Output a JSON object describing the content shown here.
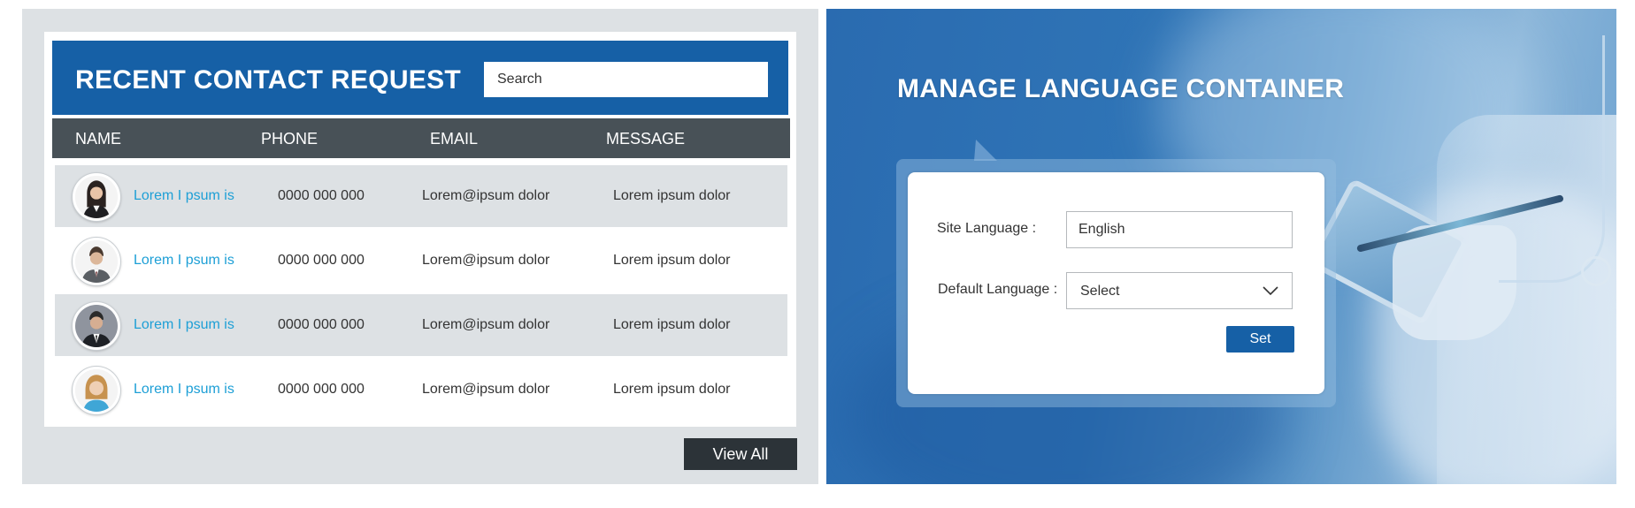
{
  "contacts": {
    "title": "RECENT CONTACT REQUEST",
    "search_placeholder": "Search",
    "columns": [
      "NAME",
      "PHONE",
      "EMAIL",
      "MESSAGE"
    ],
    "rows": [
      {
        "avatar": "avatar-woman-dark-hair-icon",
        "name": "Lorem I psum is",
        "phone": "0000 000 000",
        "email": "Lorem@ipsum dolor",
        "message": "Lorem ipsum dolor"
      },
      {
        "avatar": "avatar-man-suit-icon",
        "name": "Lorem I psum is",
        "phone": "0000 000 000",
        "email": "Lorem@ipsum dolor",
        "message": "Lorem ipsum dolor"
      },
      {
        "avatar": "avatar-man-tie-icon",
        "name": "Lorem I psum is",
        "phone": "0000 000 000",
        "email": "Lorem@ipsum dolor",
        "message": "Lorem ipsum dolor"
      },
      {
        "avatar": "avatar-woman-blonde-icon",
        "name": "Lorem I psum is",
        "phone": "0000 000 000",
        "email": "Lorem@ipsum dolor",
        "message": "Lorem ipsum dolor"
      }
    ],
    "view_all_label": "View All"
  },
  "language": {
    "title": "MANAGE LANGUAGE CONTAINER",
    "site_language_label": "Site Language :",
    "site_language_value": "English",
    "default_language_label": "Default Language :",
    "default_language_value": "Select",
    "set_label": "Set"
  },
  "colors": {
    "header_blue": "#1660a6",
    "column_bar": "#485157",
    "row_alt": "#dde1e4",
    "link_blue": "#1d9fd6",
    "button_dark": "#2c3338"
  }
}
